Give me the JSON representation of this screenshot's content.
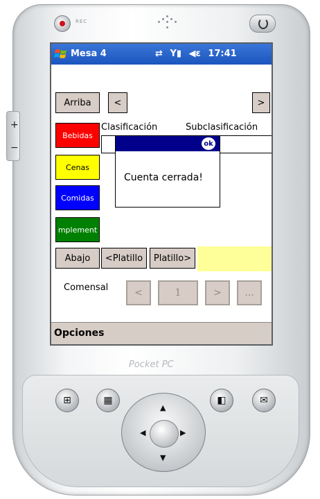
{
  "device": {
    "rec_label": "REC",
    "brand_label": "Pocket PC"
  },
  "titlebar": {
    "title": "Mesa 4",
    "time": "17:41",
    "sync_icon": "sync-arrows-icon",
    "signal_icon": "signal-icon",
    "volume_icon": "speaker-icon"
  },
  "toolbar": {
    "arriba": "Arriba",
    "prev": "<",
    "next": ">"
  },
  "categories": [
    {
      "label": "Bebidas",
      "bg": "#ff0000",
      "fg": "#ffffff"
    },
    {
      "label": "Cenas",
      "bg": "#ffff00",
      "fg": "#000000"
    },
    {
      "label": "Comidas",
      "bg": "#0000ff",
      "fg": "#ffffff"
    },
    {
      "label": "mplement",
      "bg": "#008000",
      "fg": "#ffffff"
    }
  ],
  "fields": {
    "clasificacion": "Clasificación",
    "subclasificacion": "Subclasificación"
  },
  "bottom_buttons": {
    "abajo": "Abajo",
    "prev_platillo": "<Platillo",
    "next_platillo": "Platillo>"
  },
  "comensal": {
    "label": "Comensal",
    "prev": "<",
    "value": "1",
    "next": ">",
    "more": "..."
  },
  "dialog": {
    "ok": "ok",
    "message": "Cuenta cerrada!"
  },
  "menu": {
    "opciones": "Opciones"
  },
  "colors": {
    "titlebar": "#1b55be",
    "dialog_bar": "#00008b",
    "button_bg": "#d7ccc6",
    "yellow_field": "#ffff99"
  }
}
